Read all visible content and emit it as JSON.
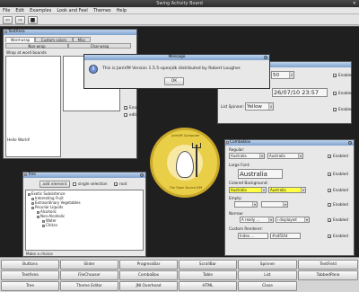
{
  "window_title": "Swing Activity Board",
  "menu": [
    "File",
    "Edit",
    "Examples",
    "Look and Feel",
    "Themes",
    "Help"
  ],
  "toolbar": {
    "back_label": "⇦",
    "forward_label": "⇨",
    "stop_label": "■"
  },
  "textarea_window": {
    "title": "TextArea",
    "tabs": [
      "Word-wrap",
      "Custom colors",
      "Misc"
    ],
    "subtabs": [
      "Non-wrap",
      "Char-wrap"
    ],
    "header": "Wrap at word bounds",
    "text": "Hello World!",
    "checkboxes": [
      {
        "label": "Enabled",
        "checked": true
      },
      {
        "label": "editable",
        "checked": true
      }
    ]
  },
  "spinner_window": {
    "spin1": {
      "value": "50"
    },
    "spin2": {
      "value": "26/07/10 23:57"
    },
    "list_label": "List Spinner:",
    "list_value": "Yellow",
    "enabled_label": "Enabled"
  },
  "message_dialog": {
    "title": "Message",
    "text": "This is JamVM Version 1.5.5-openjdk distributed by Robert Lougher.",
    "ok_label": "OK"
  },
  "logo": {
    "top_text": "JamVM Computer",
    "bottom_text": "The Open Source JVM"
  },
  "combobox_window": {
    "title": "ComboBox",
    "sections": [
      "Regular:",
      "Large Font:",
      "Colored Background:",
      "Empty:",
      "Narrow:",
      "Custom Renderer:"
    ],
    "regular": [
      "Australia",
      "Australia"
    ],
    "large": "Australia",
    "colored": [
      "Australia",
      "Australia"
    ],
    "narrow": [
      "A really ...",
      "i displayed"
    ],
    "custom": [
      "Index ...",
      "#a4f24d"
    ],
    "enabled_label": "Enabled"
  },
  "tree_window": {
    "title": "Tree",
    "add_label": "add element",
    "single_label": "single selection",
    "root_label": "root",
    "items": [
      "Exotic Subsistence",
      "Interesting Fruit",
      "Extraordinary Vegetables",
      "Peculiar Liquids",
      "Alcoholic",
      "Non-Alcoholic",
      "Water",
      "Chikra"
    ],
    "status": "Make a choice"
  },
  "bottom_buttons": [
    [
      "Buttons",
      "Slider",
      "ProgressBar",
      "ScrollBar",
      "Spinner",
      "TextField"
    ],
    [
      "TextArea",
      "FileChooser",
      "ComboBox",
      "Table",
      "List",
      "TabbedPane"
    ],
    [
      "Tree",
      "Theme Editor",
      "JNI Overhead",
      "HTML",
      "Close",
      ""
    ]
  ],
  "colors": {
    "title_gradient_top": "#bdd3ec",
    "desktop": "#1f1f1f",
    "highlight": "#ffff44"
  }
}
